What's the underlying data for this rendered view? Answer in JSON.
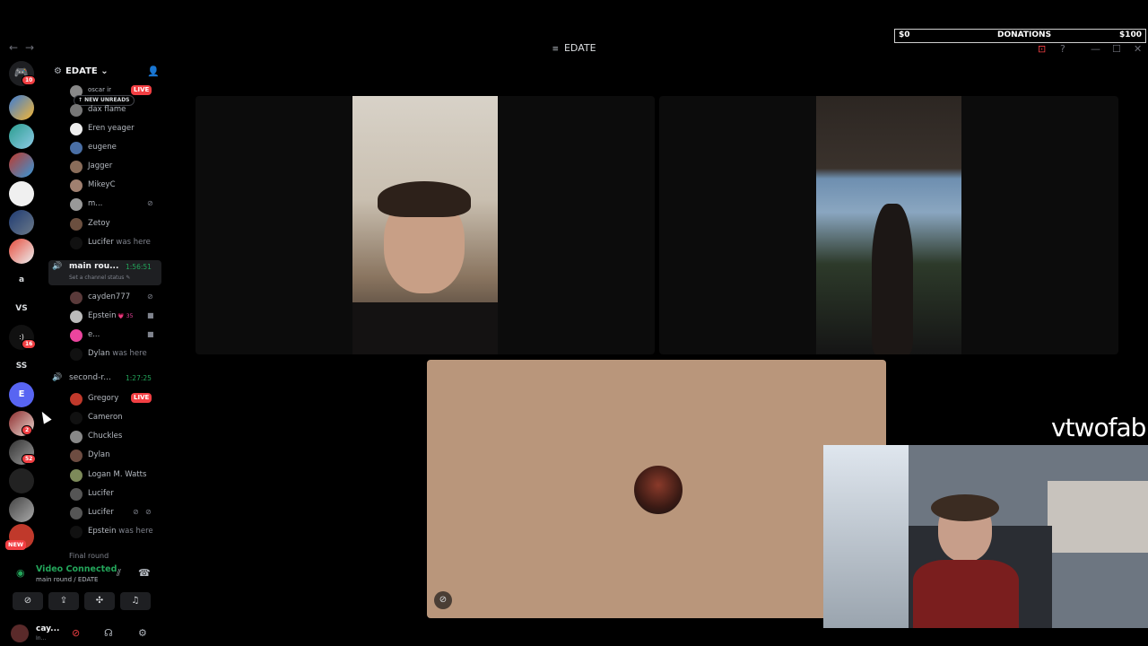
{
  "window": {
    "title": "EDATE",
    "back_icon": "←",
    "forward_icon": "→",
    "inbox_icon": "⊡",
    "help_icon": "?",
    "minimize_icon": "—",
    "maximize_icon": "☐",
    "close_icon": "✕"
  },
  "donations": {
    "left": "$0",
    "label": "DONATIONS",
    "right": "$100"
  },
  "rail": {
    "dm_badge": "10",
    "text_servers": [
      "a",
      "VS",
      "SS"
    ],
    "badges": [
      "16",
      "2",
      "52"
    ],
    "new_label": "NEW"
  },
  "server": {
    "name": "EDATE",
    "chevron": "⌄"
  },
  "new_unreads": "↑ NEW UNREADS",
  "channel1": {
    "top_partial": "oscar ir",
    "top_live": "LIVE",
    "members": [
      {
        "name": "dax flame",
        "sub": ""
      },
      {
        "name": "Eren yeager",
        "sub": ""
      },
      {
        "name": "eugene",
        "sub": ""
      },
      {
        "name": "Jagger",
        "sub": ""
      },
      {
        "name": "MikeyC",
        "sub": ""
      },
      {
        "name": "m...",
        "sub": ""
      },
      {
        "name": "Zetoy",
        "sub": ""
      },
      {
        "name": "Lucifer",
        "sub": " was here"
      }
    ]
  },
  "channel2": {
    "name": "main rou...",
    "time": "1:56:51",
    "status": "Set a channel status ✎",
    "members": [
      {
        "name": "cayden777",
        "sub": ""
      },
      {
        "name": "Epstein",
        "sub": " 💗 35"
      },
      {
        "name": "e...",
        "sub": ""
      },
      {
        "name": "Dylan",
        "sub": " was here"
      }
    ]
  },
  "channel3": {
    "name": "second-r...",
    "time": "1:27:25",
    "live": "LIVE",
    "members": [
      {
        "name": "Gregory",
        "sub": ""
      },
      {
        "name": "Cameron",
        "sub": ""
      },
      {
        "name": "Chuckles",
        "sub": ""
      },
      {
        "name": "Dylan",
        "sub": ""
      },
      {
        "name": "Logan M. Watts",
        "sub": ""
      },
      {
        "name": "Lucifer",
        "sub": ""
      },
      {
        "name": "Lucifer",
        "sub": ""
      },
      {
        "name": "Epstein",
        "sub": " was here"
      }
    ],
    "next_partial": "Final round"
  },
  "voice_panel": {
    "title": "Video Connected",
    "subtitle": "main round / EDATE"
  },
  "user": {
    "name": "cay...",
    "status": "In..."
  },
  "overlay_text": "vtwofab",
  "colors": {
    "accent_green": "#23a55a",
    "live_red": "#f23f43",
    "tile_bg": "#0c0c0c",
    "tan_tile": "#b9967b"
  }
}
